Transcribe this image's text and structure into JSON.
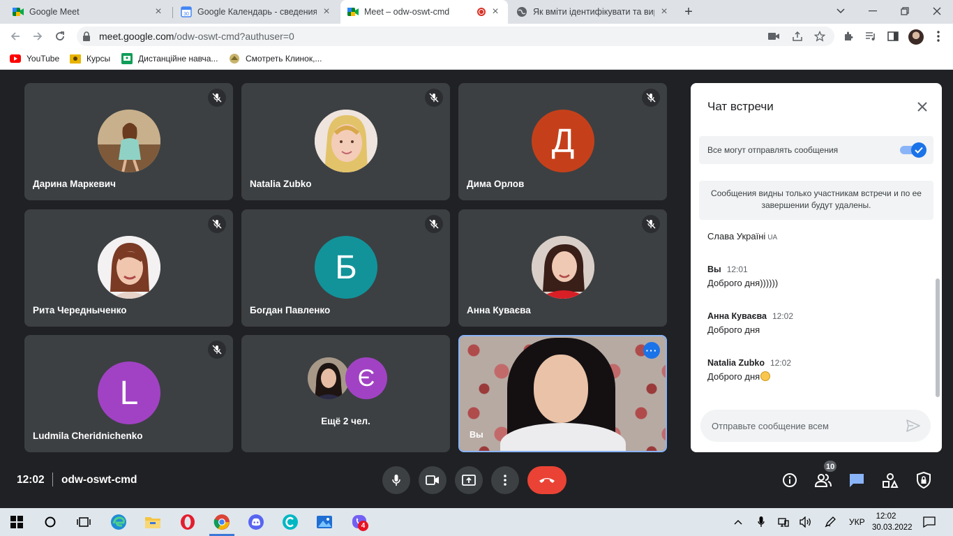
{
  "browser": {
    "tabs": [
      {
        "title": "Google Meet",
        "icon": "google-meet-icon"
      },
      {
        "title": "Google Календарь - сведения о",
        "icon": "google-calendar-icon"
      },
      {
        "title": "Meet – odw-oswt-cmd",
        "icon": "google-meet-icon",
        "active": true
      },
      {
        "title": "Як вміти ідентифікувати та вирі",
        "icon": "globe-icon"
      }
    ],
    "url_domain": "meet.google.com",
    "url_path": "/odw-oswt-cmd?authuser=0",
    "bookmarks": [
      {
        "label": "YouTube",
        "icon": "youtube-icon"
      },
      {
        "label": "Курсы",
        "icon": "folder-icon"
      },
      {
        "label": "Дистанційне навча...",
        "icon": "classroom-icon"
      },
      {
        "label": "Смотреть Клинок,...",
        "icon": "site-icon"
      }
    ]
  },
  "meet": {
    "participants": [
      {
        "name": "Дарина Маркевич",
        "avatar_type": "photo",
        "muted": true
      },
      {
        "name": "Natalia Zubko",
        "avatar_type": "photo",
        "muted": true
      },
      {
        "name": "Дима Орлов",
        "initial": "Д",
        "avatar_color": "#c5401a",
        "muted": true
      },
      {
        "name": "Рита Чередныченко",
        "avatar_type": "photo",
        "muted": true
      },
      {
        "name": "Богдан Павленко",
        "initial": "Б",
        "avatar_color": "#12939a",
        "muted": true
      },
      {
        "name": "Анна Куваєва",
        "avatar_type": "photo",
        "muted": true
      },
      {
        "name": "Ludmila Cheridnichenko",
        "initial": "L",
        "avatar_color": "#a142c4",
        "muted": true
      }
    ],
    "more": {
      "label": "Ещё 2 чел.",
      "initial": "Є",
      "avatar_color": "#a142c4"
    },
    "self": {
      "name": "Вы"
    },
    "time": "12:02",
    "meeting_code": "odw-oswt-cmd",
    "participant_count": "10"
  },
  "chat": {
    "title": "Чат встречи",
    "permission_label": "Все могут отправлять сообщения",
    "permission_enabled": true,
    "notice": "Сообщения видны только участникам встречи и по ее завершении будут удалены.",
    "first_message": {
      "text": "Слава Україні",
      "suffix": "UA"
    },
    "messages": [
      {
        "author": "Вы",
        "time": "12:01",
        "text": "Доброго дня))))))"
      },
      {
        "author": "Анна Куваєва",
        "time": "12:02",
        "text": "Доброго дня"
      },
      {
        "author": "Natalia Zubko",
        "time": "12:02",
        "text": "Доброго дня"
      }
    ],
    "input_placeholder": "Отправьте сообщение всем"
  },
  "taskbar": {
    "language": "УКР",
    "time": "12:02",
    "date": "30.03.2022",
    "viber_badge": "4"
  },
  "colors": {
    "meet_bg": "#202124",
    "tile_bg": "#3c4043",
    "hangup": "#ea4335",
    "accent_blue": "#1a73e8"
  }
}
